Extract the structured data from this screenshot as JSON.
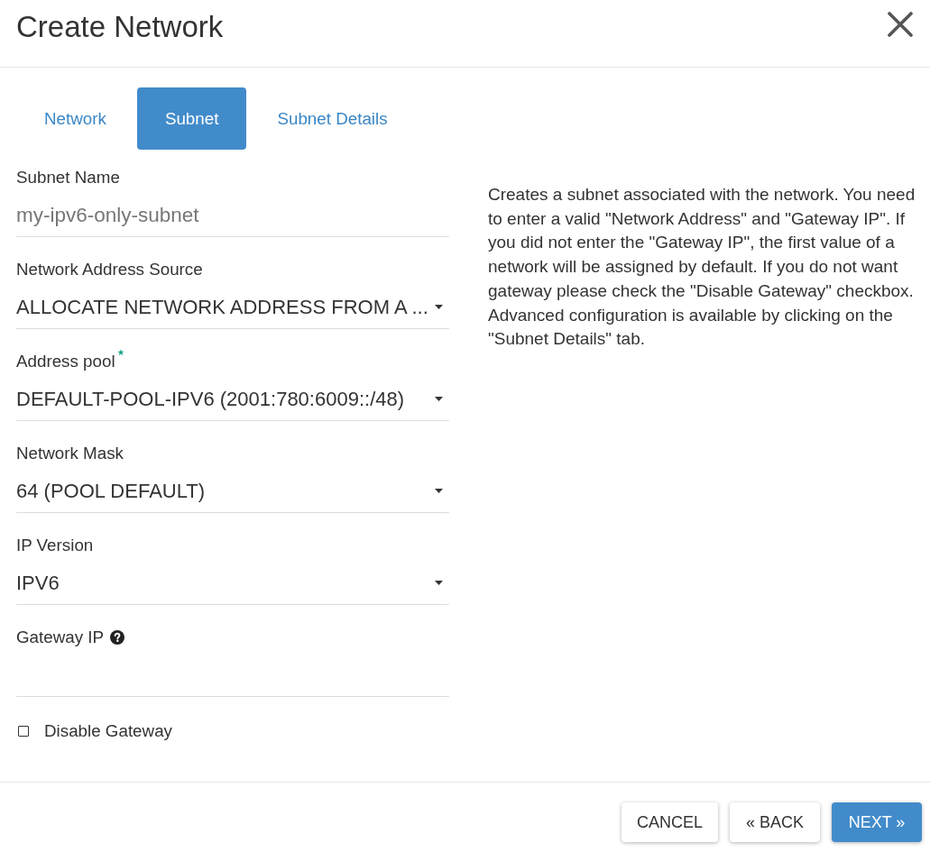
{
  "dialog": {
    "title": "Create Network"
  },
  "tabs": [
    {
      "label": "Network",
      "selected": false
    },
    {
      "label": "Subnet",
      "selected": true
    },
    {
      "label": "Subnet Details",
      "selected": false
    }
  ],
  "fields": [
    {
      "kind": "text",
      "label": "Subnet Name",
      "placeholder": "my-ipv6-only-subnet",
      "required": false,
      "help": false
    },
    {
      "kind": "select",
      "label": "Network Address Source",
      "value": "ALLOCATE NETWORK ADDRESS FROM A ...",
      "required": false,
      "help": false
    },
    {
      "kind": "select",
      "label": "Address pool",
      "value": "DEFAULT-POOL-IPV6 (2001:780:6009::/48)",
      "required": true,
      "help": false
    },
    {
      "kind": "select",
      "label": "Network Mask",
      "value": "64 (POOL DEFAULT)",
      "required": false,
      "help": false
    },
    {
      "kind": "select",
      "label": "IP Version",
      "value": "IPV6",
      "required": false,
      "help": false
    },
    {
      "kind": "text",
      "label": "Gateway IP",
      "required": false,
      "help": true
    }
  ],
  "checkbox": {
    "label": "Disable Gateway",
    "checked": false
  },
  "description": "Creates a subnet associated with the network. You need to enter a valid \"Network Address\" and \"Gateway IP\". If you did not enter the \"Gateway IP\", the first value of a network will be assigned by default. If you do not want gateway please check the \"Disable Gateway\" checkbox. Advanced configuration is available by clicking on the \"Subnet Details\" tab.",
  "buttons": [
    {
      "kind": "default",
      "label": "CANCEL"
    },
    {
      "kind": "default",
      "label": "« BACK"
    },
    {
      "kind": "primary",
      "label": "NEXT »"
    }
  ]
}
